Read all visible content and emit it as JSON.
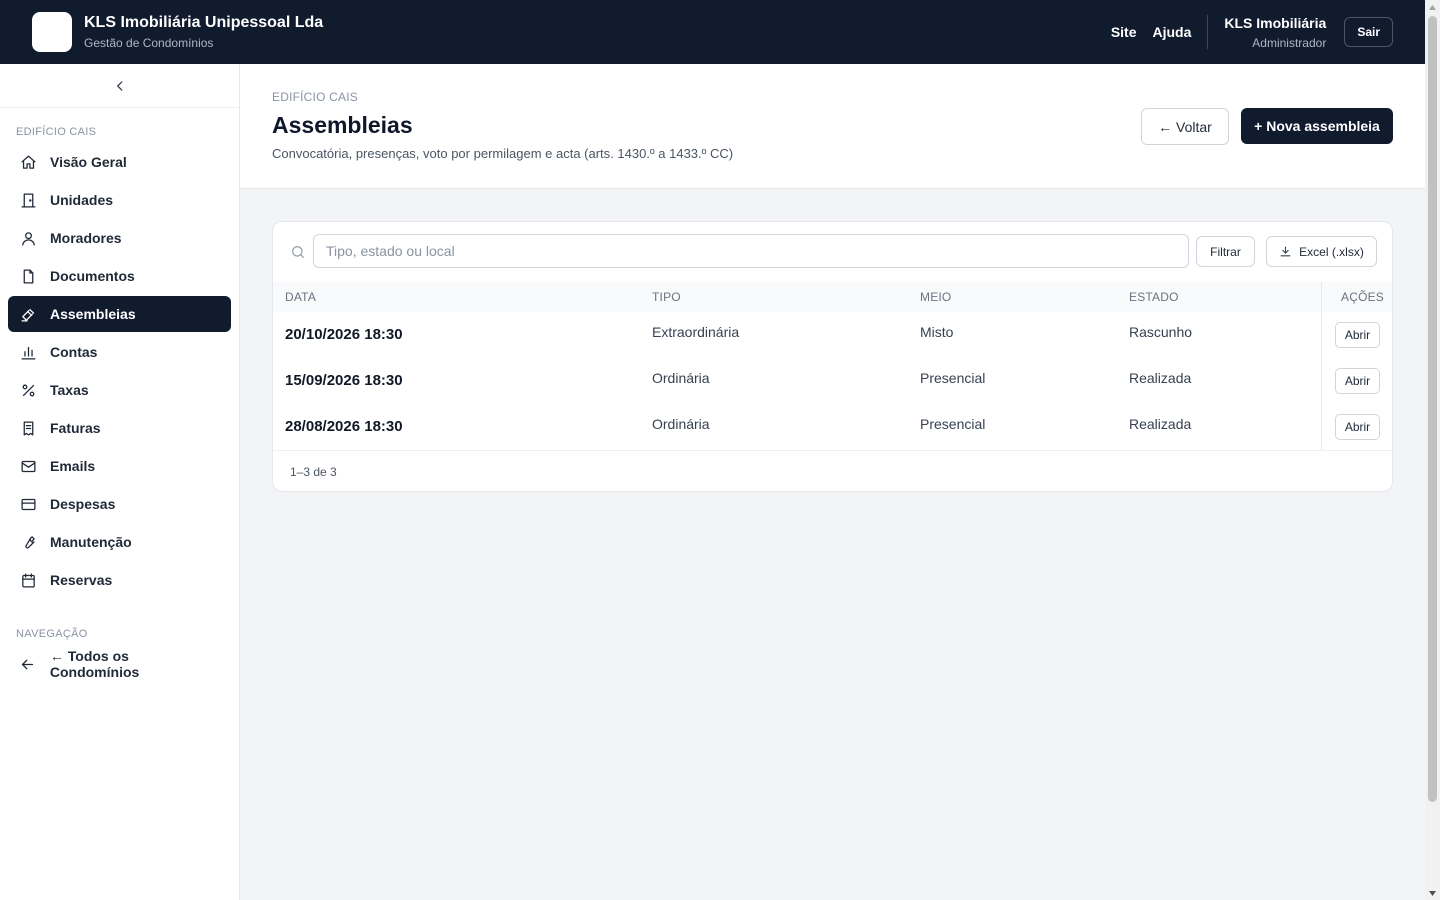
{
  "header": {
    "company": "KLS Imobiliária Unipessoal Lda",
    "subtitle": "Gestão de Condomínios",
    "links": [
      "Site",
      "Ajuda"
    ],
    "user_name": "KLS Imobiliária",
    "user_role": "Administrador",
    "logout_label": "Sair"
  },
  "sidebar": {
    "section_building": "EDIFÍCIO CAIS",
    "items": [
      {
        "label": "Visão Geral",
        "icon": "home-icon"
      },
      {
        "label": "Unidades",
        "icon": "door-icon"
      },
      {
        "label": "Moradores",
        "icon": "user-icon"
      },
      {
        "label": "Documentos",
        "icon": "file-icon"
      },
      {
        "label": "Assembleias",
        "icon": "gavel-icon",
        "active": true
      },
      {
        "label": "Contas",
        "icon": "bar-chart-icon"
      },
      {
        "label": "Taxas",
        "icon": "percent-icon"
      },
      {
        "label": "Faturas",
        "icon": "receipt-icon"
      },
      {
        "label": "Emails",
        "icon": "mail-icon"
      },
      {
        "label": "Despesas",
        "icon": "credit-card-icon"
      },
      {
        "label": "Manutenção",
        "icon": "wrench-icon"
      },
      {
        "label": "Reservas",
        "icon": "calendar-icon"
      }
    ],
    "section_nav": "NAVEGAÇÃO",
    "back_all": "← Todos os Condomínios"
  },
  "page": {
    "breadcrumb": "EDIFÍCIO CAIS",
    "title": "Assembleias",
    "description": "Convocatória, presenças, voto por permilagem e acta (arts. 1430.º a 1433.º CC)",
    "back_label": "← Voltar",
    "new_label": "+ Nova assembleia"
  },
  "toolbar": {
    "search_placeholder": "Tipo, estado ou local",
    "filter_label": "Filtrar",
    "excel_label": "Excel (.xlsx)"
  },
  "table": {
    "columns": [
      "DATA",
      "TIPO",
      "MEIO",
      "ESTADO",
      "AÇÕES"
    ],
    "rows": [
      {
        "date": "20/10/2026 18:30",
        "type": "Extraordinária",
        "medium": "Misto",
        "status": "Rascunho",
        "action": "Abrir"
      },
      {
        "date": "15/09/2026 18:30",
        "type": "Ordinária",
        "medium": "Presencial",
        "status": "Realizada",
        "action": "Abrir"
      },
      {
        "date": "28/08/2026 18:30",
        "type": "Ordinária",
        "medium": "Presencial",
        "status": "Realizada",
        "action": "Abrir"
      }
    ],
    "pagination": "1–3 de 3"
  },
  "colors": {
    "navy": "#111b2e",
    "accent_text": "#ffffff"
  }
}
